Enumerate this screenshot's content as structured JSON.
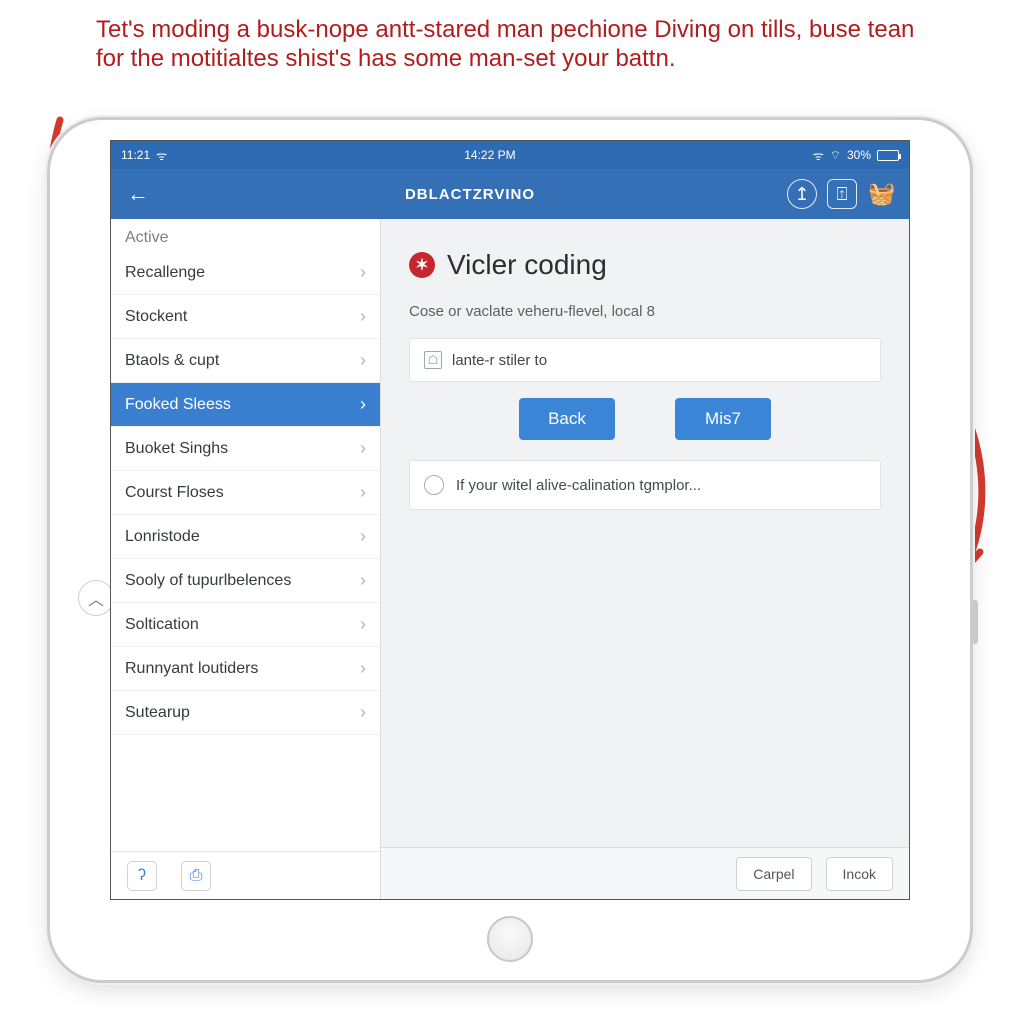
{
  "caption": "Tet's moding a busk-nope antt-stared man pechione Diving on tills, buse tean for the motitialtes shist's has some man-set your battn.",
  "statusbar": {
    "time_left": "11:21",
    "time_center": "14:22 PM",
    "battery_pct": "30%"
  },
  "header": {
    "title": "DBLACTZRVINO"
  },
  "sidebar": {
    "section": "Active",
    "items": [
      "Recallenge",
      "Stockent",
      "Btaols & cupt",
      "Fooked Sleess",
      "Buoket Singhs",
      "Courst Floses",
      "Lonristode",
      "Sooly of tupurlbelences",
      "Soltication",
      "Runnyant loutiders",
      "Sutearup"
    ],
    "active_index": 3
  },
  "main": {
    "title": "Vicler coding",
    "subtitle": "Cose or vaclate veheru-flevel, local 8",
    "card_text": "lante-r stiler to",
    "btn_back": "Back",
    "btn_next": "Mis7",
    "radio_text": "If your witel alive-calination tgmplor..."
  },
  "footer": {
    "cancel": "Carpel",
    "ok": "Incok"
  }
}
